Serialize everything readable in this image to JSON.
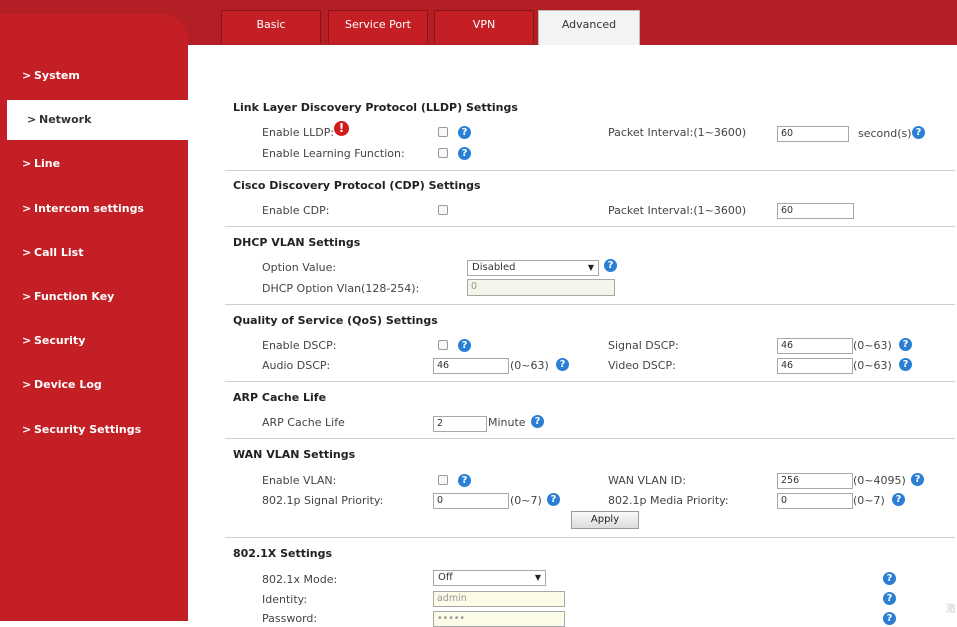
{
  "tabs": [
    "Basic",
    "Service Port",
    "VPN",
    "Advanced"
  ],
  "active_tab": "Advanced",
  "sidebar": {
    "items": [
      {
        "label": "System",
        "active": false
      },
      {
        "label": "Network",
        "active": true
      },
      {
        "label": "Line",
        "active": false
      },
      {
        "label": "Intercom settings",
        "active": false
      },
      {
        "label": "Call List",
        "active": false
      },
      {
        "label": "Function Key",
        "active": false
      },
      {
        "label": "Security",
        "active": false
      },
      {
        "label": "Device Log",
        "active": false
      },
      {
        "label": "Security Settings",
        "active": false
      }
    ],
    "chevron": ">"
  },
  "lldp": {
    "title": "Link Layer Discovery Protocol (LLDP) Settings",
    "enable_label": "Enable LLDP:",
    "learning_label": "Enable Learning Function:",
    "interval_label": "Packet Interval:(1~3600)",
    "interval_value": "60",
    "interval_unit": "second(s)"
  },
  "cdp": {
    "title": "Cisco Discovery Protocol (CDP) Settings",
    "enable_label": "Enable CDP:",
    "interval_label": "Packet Interval:(1~3600)",
    "interval_value": "60"
  },
  "dhcp_vlan": {
    "title": "DHCP VLAN Settings",
    "option_label": "Option Value:",
    "option_value": "Disabled",
    "vlan_label": "DHCP Option Vlan(128-254):",
    "vlan_value": "0"
  },
  "qos": {
    "title": "Quality of Service (QoS) Settings",
    "enable_label": "Enable DSCP:",
    "signal_label": "Signal DSCP:",
    "signal_value": "46",
    "audio_label": "Audio DSCP:",
    "audio_value": "46",
    "video_label": "Video DSCP:",
    "video_value": "46",
    "range": "(0~63)"
  },
  "arp": {
    "title": "ARP Cache Life",
    "label": "ARP Cache Life",
    "value": "2",
    "unit": "Minute"
  },
  "wan_vlan": {
    "title": "WAN VLAN Settings",
    "enable_label": "Enable VLAN:",
    "id_label": "WAN VLAN ID:",
    "id_value": "256",
    "id_range": "(0~4095)",
    "signal_prio_label": "802.1p Signal Priority:",
    "signal_prio_value": "0",
    "media_prio_label": "802.1p Media Priority:",
    "media_prio_value": "0",
    "prio_range": "(0~7)",
    "apply_label": "Apply"
  },
  "dot1x": {
    "title": "802.1X Settings",
    "mode_label": "802.1x Mode:",
    "mode_value": "Off",
    "identity_label": "Identity:",
    "identity_value": "admin",
    "password_label": "Password:",
    "password_value": "•••••"
  },
  "watermark": "激"
}
